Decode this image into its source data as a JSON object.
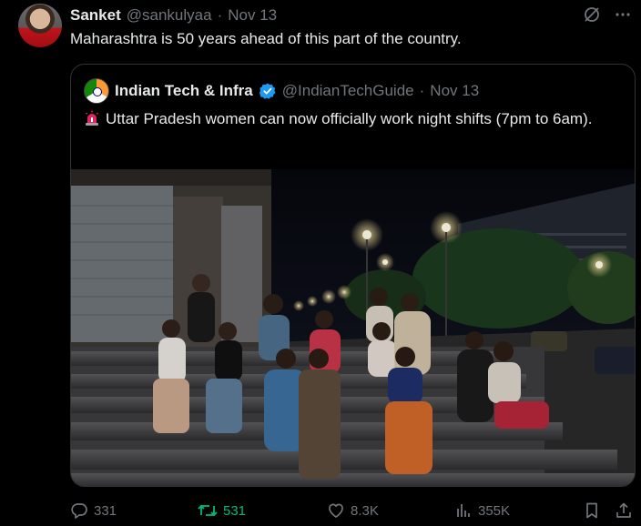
{
  "author": {
    "name": "Sanket",
    "handle": "@sankulyaa",
    "separator": "·",
    "date": "Nov 13"
  },
  "tweet": {
    "text": "Maharashtra is 50 years ahead of this part of the country."
  },
  "quote": {
    "name": "Indian Tech & Infra",
    "handle": "@IndianTechGuide",
    "separator": "·",
    "date": "Nov 13",
    "text": "Uttar Pradesh women can now officially work night shifts (7pm to 6am).",
    "emoji_icon": "rotating-light-icon"
  },
  "actions": {
    "replies": "331",
    "retweets": "531",
    "likes": "8.3K",
    "views": "355K"
  },
  "colors": {
    "background": "#000000",
    "text": "#e7e9ea",
    "muted": "#71767b",
    "border": "#2f3336",
    "verified": "#1d9bf0",
    "retweet_active": "#00ba7c"
  },
  "icons": [
    "grok-icon",
    "more-icon",
    "verified-icon",
    "reply-icon",
    "retweet-icon",
    "like-icon",
    "views-icon",
    "bookmark-icon",
    "share-icon"
  ]
}
